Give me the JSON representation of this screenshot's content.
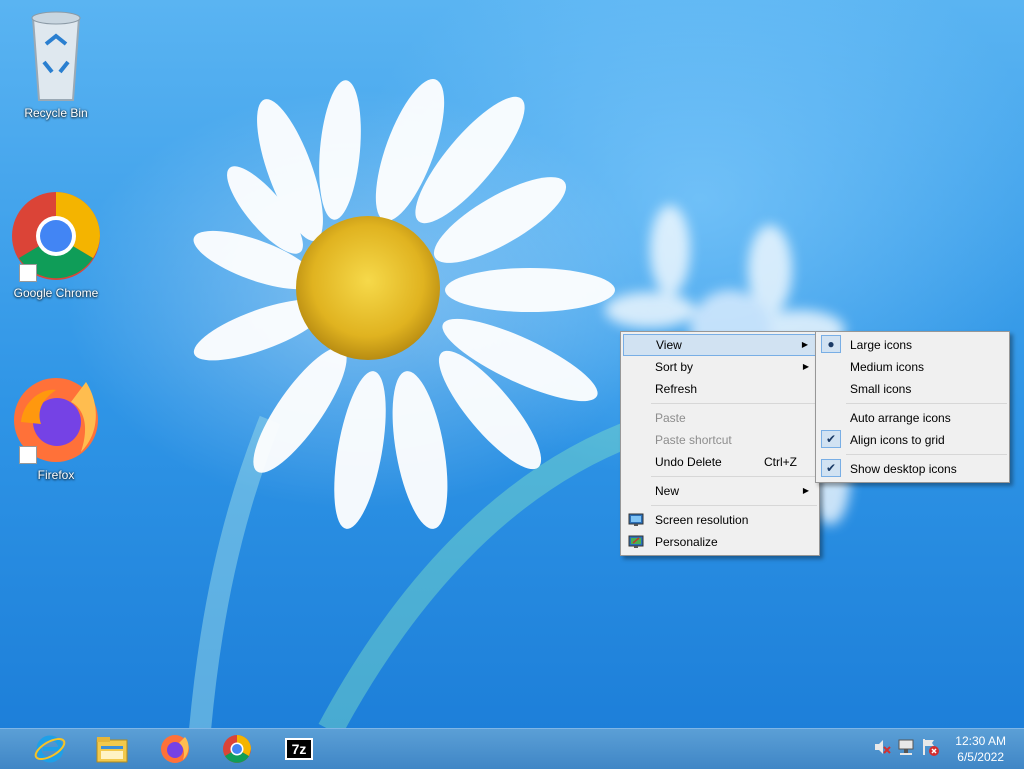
{
  "desktop": {
    "icons": [
      {
        "label": "Recycle Bin",
        "icon": "recycle-bin-icon"
      },
      {
        "label": "Google Chrome",
        "icon": "chrome-icon"
      },
      {
        "label": "Firefox",
        "icon": "firefox-icon"
      }
    ]
  },
  "context_menu": {
    "items": [
      {
        "label": "View",
        "submenu": true,
        "highlighted": true
      },
      {
        "label": "Sort by",
        "submenu": true
      },
      {
        "label": "Refresh"
      },
      {
        "label": "Paste",
        "disabled": true
      },
      {
        "label": "Paste shortcut",
        "disabled": true
      },
      {
        "label": "Undo Delete",
        "shortcut": "Ctrl+Z"
      },
      {
        "label": "New",
        "submenu": true
      },
      {
        "label": "Screen resolution",
        "icon": "screen-resolution-icon"
      },
      {
        "label": "Personalize",
        "icon": "personalize-icon"
      }
    ]
  },
  "view_submenu": {
    "items": [
      {
        "label": "Large icons",
        "state": "radio-selected"
      },
      {
        "label": "Medium icons"
      },
      {
        "label": "Small icons"
      },
      {
        "label": "Auto arrange icons"
      },
      {
        "label": "Align icons to grid",
        "state": "checked"
      },
      {
        "label": "Show desktop icons",
        "state": "checked"
      }
    ]
  },
  "taskbar": {
    "pinned": [
      {
        "name": "Internet Explorer",
        "icon": "internet-explorer-icon"
      },
      {
        "name": "File Explorer",
        "icon": "file-explorer-icon"
      },
      {
        "name": "Firefox",
        "icon": "firefox-icon"
      },
      {
        "name": "Google Chrome",
        "icon": "chrome-icon"
      },
      {
        "name": "7-Zip",
        "icon": "7zip-icon",
        "text": "7z"
      }
    ],
    "tray_icons": [
      "volume-muted-icon",
      "network-icon",
      "action-center-icon"
    ],
    "clock": {
      "time": "12:30 AM",
      "date": "6/5/2022"
    }
  },
  "colors": {
    "menu_background": "#f0f0f0",
    "menu_highlight": "#d1e2f2",
    "menu_highlight_border": "#78aee5",
    "disabled_text": "#8d8d8d",
    "taskbar": "#4a8fcd"
  }
}
